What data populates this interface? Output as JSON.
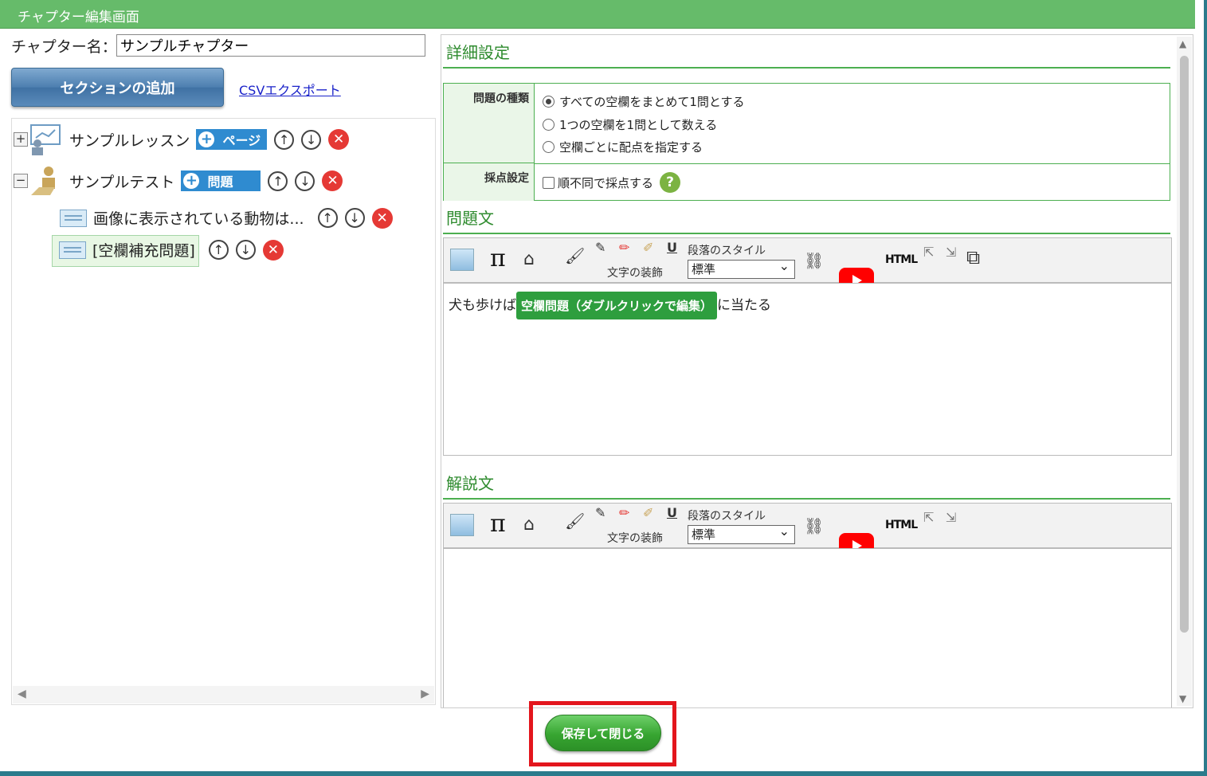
{
  "window": {
    "title": "チャプター編集画面"
  },
  "chapter": {
    "name_label": "チャプター名：",
    "name_value": "サンプルチャプター"
  },
  "actions": {
    "add_section": "セクションの追加",
    "csv_export": "CSVエクスポート",
    "save_close": "保存して閉じる"
  },
  "tree": {
    "lesson": {
      "expander": "+",
      "label": "サンプルレッスン",
      "add_label": "ページ"
    },
    "test": {
      "expander": "−",
      "label": "サンプルテスト",
      "add_label": "問題"
    },
    "items": [
      {
        "label": "画像に表示されている動物は..."
      },
      {
        "label": "[空欄補充問題]",
        "selected": true
      }
    ]
  },
  "detail": {
    "title": "詳細設定",
    "question_type": {
      "label": "問題の種類",
      "options": [
        "すべての空欄をまとめて1問とする",
        "1つの空欄を1問として数える",
        "空欄ごとに配点を指定する"
      ],
      "selected_index": 0
    },
    "scoring": {
      "label": "採点設定",
      "option": "順不同で採点する",
      "checked": false,
      "help": "?"
    }
  },
  "question": {
    "title": "問題文",
    "text_before": "犬も歩けば",
    "blank_chip": "空欄問題（ダブルクリックで編集）",
    "text_after": "に当たる"
  },
  "explanation": {
    "title": "解説文",
    "text": ""
  },
  "toolbar": {
    "decoration_label": "文字の装飾",
    "paragraph_style_label": "段落のスタイル",
    "paragraph_style_value": "標準",
    "html_label": "HTML",
    "pi": "π"
  }
}
